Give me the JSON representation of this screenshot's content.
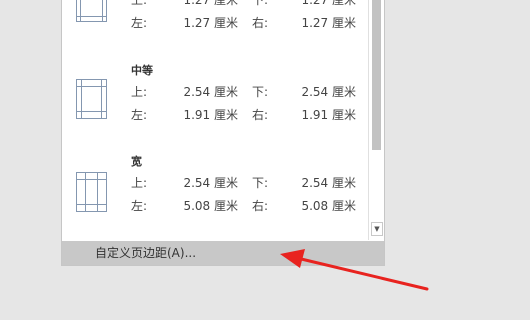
{
  "margins_menu": {
    "options": [
      {
        "name": "",
        "icon": "page-margins-narrow-icon",
        "rows": [
          {
            "l1": "上:",
            "v1": "1.27 厘米",
            "l2": "下:",
            "v2": "1.27 厘米"
          },
          {
            "l1": "左:",
            "v1": "1.27 厘米",
            "l2": "右:",
            "v2": "1.27 厘米"
          }
        ]
      },
      {
        "name": "中等",
        "icon": "page-margins-moderate-icon",
        "rows": [
          {
            "l1": "上:",
            "v1": "2.54 厘米",
            "l2": "下:",
            "v2": "2.54 厘米"
          },
          {
            "l1": "左:",
            "v1": "1.91 厘米",
            "l2": "右:",
            "v2": "1.91 厘米"
          }
        ]
      },
      {
        "name": "宽",
        "icon": "page-margins-wide-icon",
        "rows": [
          {
            "l1": "上:",
            "v1": "2.54 厘米",
            "l2": "下:",
            "v2": "2.54 厘米"
          },
          {
            "l1": "左:",
            "v1": "5.08 厘米",
            "l2": "右:",
            "v2": "5.08 厘米"
          }
        ]
      }
    ],
    "custom_label": "自定义页边距(A)...",
    "scroll_down_icon": "scroll-down-arrow-icon"
  },
  "annotation": {
    "icon": "red-arrow-annotation",
    "color": "#e8231f"
  },
  "colors": {
    "background": "#e6e6e6",
    "menu_background": "#ffffff",
    "highlight": "#c8c8c8",
    "page_icon_stroke": "#8497b0"
  }
}
